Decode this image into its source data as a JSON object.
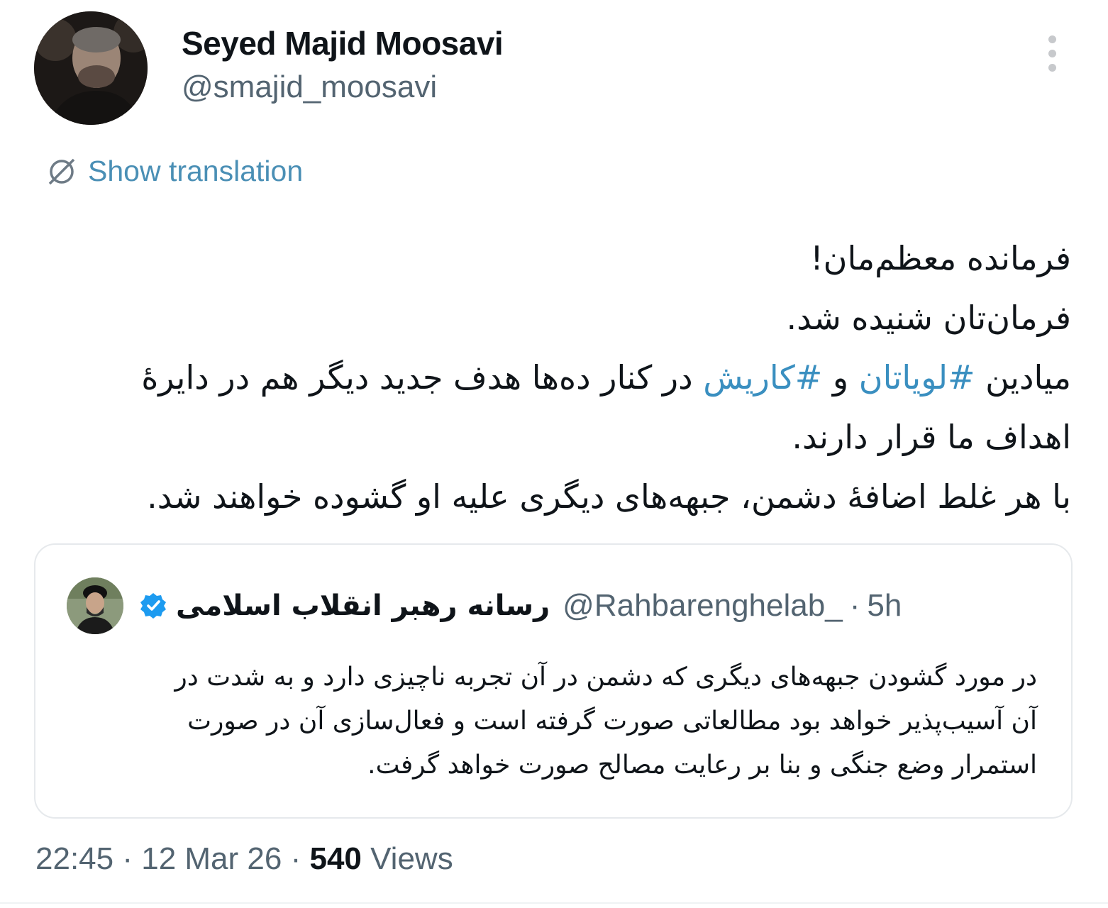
{
  "author": {
    "display_name": "Seyed Majid Moosavi",
    "handle": "@smajid_moosavi"
  },
  "actions": {
    "more_icon": "three-dots-vertical",
    "translate_icon": "globe-icon",
    "translate_label": "Show translation"
  },
  "tweet": {
    "line1": "فرمانده معظم‌مان!",
    "line2": "فرمان‌تان شنیده شد.",
    "line3_prefix": "میادین ",
    "hashtag1": "#لویاتان",
    "line3_mid": " و ",
    "hashtag2": "#کاریش",
    "line3_suffix": " در کنار ده‌ها هدف جدید دیگر هم در دایرهٔ",
    "line4": "اهداف ما قرار دارند.",
    "line5": "با هر غلط اضافهٔ دشمن، جبهه‌های دیگری علیه او گشوده خواهند شد."
  },
  "quoted": {
    "name": "رسانه رهبر انقلاب اسلامی",
    "verified_icon": "verified-badge-icon",
    "handle": "@Rahbarenghelab_",
    "separator": "·",
    "time": "5h",
    "lines": [
      "در مورد گشودن جبهه‌های دیگری که دشمن در آن تجربه ناچیزی دارد و به شدت در",
      "آن آسیب‌پذیر خواهد بود مطالعاتی صورت گرفته است و فعال‌سازی آن در صورت",
      "استمرار وضع جنگی و بنا بر رعایت مصالح صورت خواهد گرفت."
    ]
  },
  "meta": {
    "time": "22:45",
    "sep1": "·",
    "date": "12 Mar 26",
    "sep2": "·",
    "views_count": "540",
    "views_label": "Views"
  },
  "colors": {
    "link": "#3a8fc0",
    "muted": "#536471",
    "verified": "#1d9bf0"
  }
}
